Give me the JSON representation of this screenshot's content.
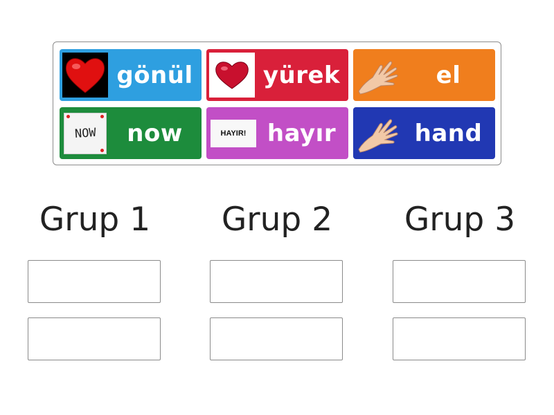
{
  "tiles": [
    {
      "label": "gönül",
      "color": "#2e9fe0",
      "icon": "heart-icon"
    },
    {
      "label": "yürek",
      "color": "#d9203a",
      "icon": "heart-icon"
    },
    {
      "label": "el",
      "color": "#f07e1d",
      "icon": "hand-icon"
    },
    {
      "label": "now",
      "color": "#1d8c3c",
      "icon": "now-note-icon",
      "icon_text": "NOW"
    },
    {
      "label": "hayır",
      "color": "#c24fc6",
      "icon": "hayir-sign-icon",
      "icon_text": "HAYIR!"
    },
    {
      "label": "hand",
      "color": "#2138b3",
      "icon": "hand-icon"
    }
  ],
  "groups": [
    {
      "title": "Grup 1"
    },
    {
      "title": "Grup 2"
    },
    {
      "title": "Grup 3"
    }
  ]
}
